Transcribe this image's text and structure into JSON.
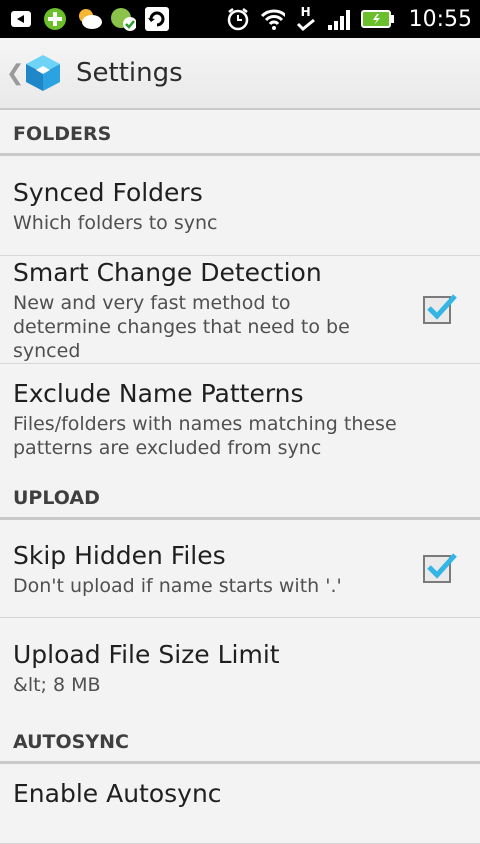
{
  "status_bar": {
    "time": "10:55",
    "icons": [
      "back-icon",
      "plus-icon",
      "weather-icon",
      "sync-status-icon",
      "refresh-icon",
      "alarm-icon",
      "wifi-icon",
      "hsdpa-icon",
      "signal-icon",
      "battery-icon"
    ],
    "indicator_letter": "H"
  },
  "action_bar": {
    "title": "Settings",
    "up_glyph": "❮"
  },
  "sections": [
    {
      "header": "FOLDERS",
      "items": [
        {
          "title": "Synced Folders",
          "subtitle": "Which folders to sync",
          "checkbox": null
        },
        {
          "title": "Smart Change Detection",
          "subtitle": "New and very fast method to determine changes that need to be synced",
          "checkbox": true
        },
        {
          "title": "Exclude Name Patterns",
          "subtitle": "Files/folders with names matching these patterns are excluded from sync",
          "checkbox": null
        }
      ]
    },
    {
      "header": "UPLOAD",
      "items": [
        {
          "title": "Skip Hidden Files",
          "subtitle": "Don't upload if name starts with '.'",
          "checkbox": true
        },
        {
          "title": "Upload File Size Limit",
          "subtitle": "&lt; 8 MB",
          "checkbox": null
        }
      ]
    },
    {
      "header": "AUTOSYNC",
      "items": [
        {
          "title": "Enable Autosync",
          "subtitle": "",
          "checkbox": null
        }
      ]
    }
  ],
  "colors": {
    "checkmark": "#33b5e5",
    "background": "#f3f3f3",
    "divider": "#c9c9c9"
  }
}
